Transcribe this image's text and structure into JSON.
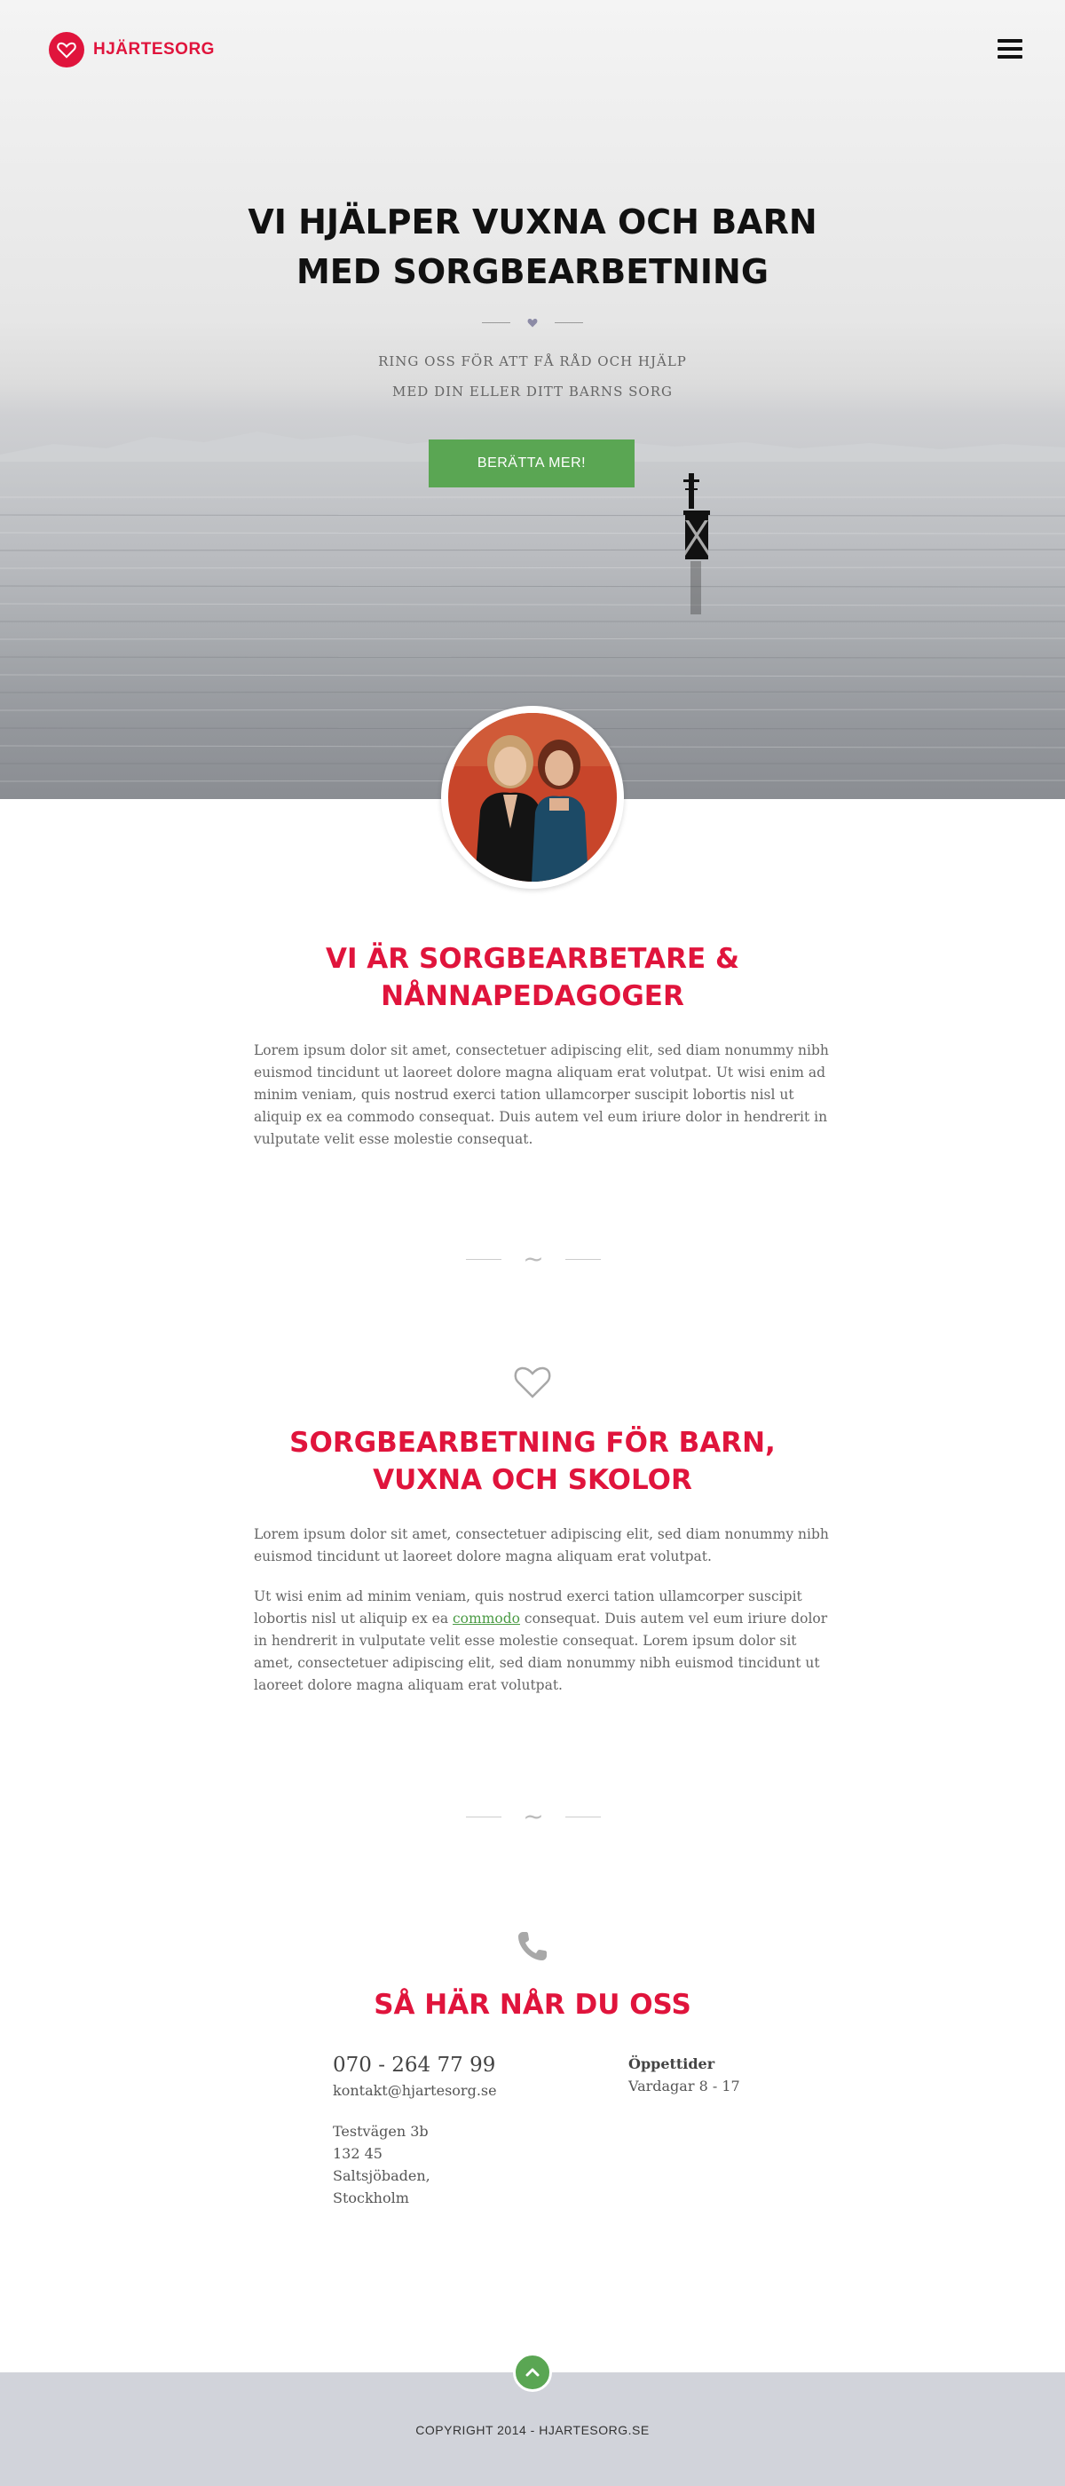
{
  "brand": {
    "name": "HJÄRTESORG",
    "accent": "#e0143c",
    "button_color": "#5aa653"
  },
  "header": {
    "menu_icon": "hamburger-menu-icon"
  },
  "hero": {
    "title_line1": "VI HJÄLPER VUXNA OCH BARN",
    "title_line2": "MED SORGBEARBETNING",
    "divider_icon": "heart-icon",
    "subtitle_line1": "RING OSS FÖR ATT FÅ RÅD OCH HJÄLP",
    "subtitle_line2": "MED DIN ELLER DITT BARNS SORG",
    "cta_label": "BERÄTTA MER!"
  },
  "about": {
    "title_line1": "VI ÄR SORGBEARBETARE &",
    "title_line2": "NÅNNAPEDAGOGER",
    "paragraph": "Lorem ipsum dolor sit amet, consectetuer adipiscing elit, sed diam nonummy nibh euismod tincidunt ut laoreet dolore magna aliquam erat volutpat. Ut wisi enim ad minim veniam, quis nostrud exerci tation ullamcorper suscipit lobortis nisl ut aliquip ex ea commodo consequat. Duis autem vel eum iriure dolor in hendrerit in vulputate velit esse molestie consequat."
  },
  "services": {
    "icon": "heart-outline-icon",
    "title_line1": "SORGBEARBETNING FÖR BARN,",
    "title_line2": "VUXNA OCH SKOLOR",
    "paragraph1": "Lorem ipsum dolor sit amet, consectetuer adipiscing elit, sed diam nonummy nibh euismod tincidunt ut laoreet dolore magna aliquam erat volutpat.",
    "paragraph2_before": "Ut wisi enim ad minim veniam, quis nostrud exerci tation ullamcorper suscipit lobortis nisl ut aliquip ex ea ",
    "paragraph2_link": "commodo",
    "paragraph2_after": " consequat. Duis autem vel eum iriure dolor in hendrerit in vulputate velit esse molestie consequat. Lorem ipsum dolor sit amet, consectetuer adipiscing elit, sed diam nonummy nibh euismod tincidunt ut laoreet dolore magna aliquam erat volutpat."
  },
  "contact": {
    "icon": "phone-icon",
    "title": "SÅ HÄR NÅR DU OSS",
    "phone": "070 - 264 77 99",
    "email": "kontakt@hjartesorg.se",
    "address": [
      "Testvägen 3b",
      "132 45",
      "Saltsjöbaden,",
      "Stockholm"
    ],
    "hours_title": "Öppettider",
    "hours_value": "Vardagar 8 - 17"
  },
  "footer": {
    "copyright": "COPYRIGHT 2014 - HJARTESORG.SE",
    "back_to_top_icon": "chevron-up-icon"
  }
}
